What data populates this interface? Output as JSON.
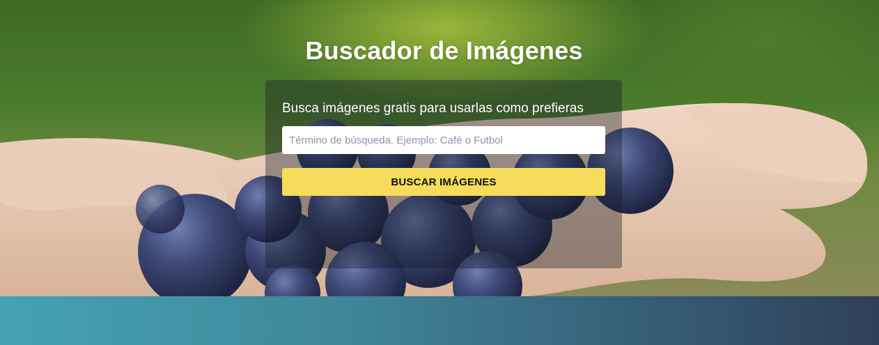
{
  "header": {
    "title": "Buscador de Imágenes"
  },
  "search": {
    "subtitle": "Busca imágenes gratis para usarlas como prefieras",
    "placeholder": "Término de búsqueda. Ejemplo: Café o Futbol",
    "value": "",
    "button_label": "BUSCAR IMÁGENES"
  },
  "colors": {
    "button": "#f5dc5b",
    "footer_start": "#45a3b3",
    "footer_end": "#2f3f5a"
  }
}
